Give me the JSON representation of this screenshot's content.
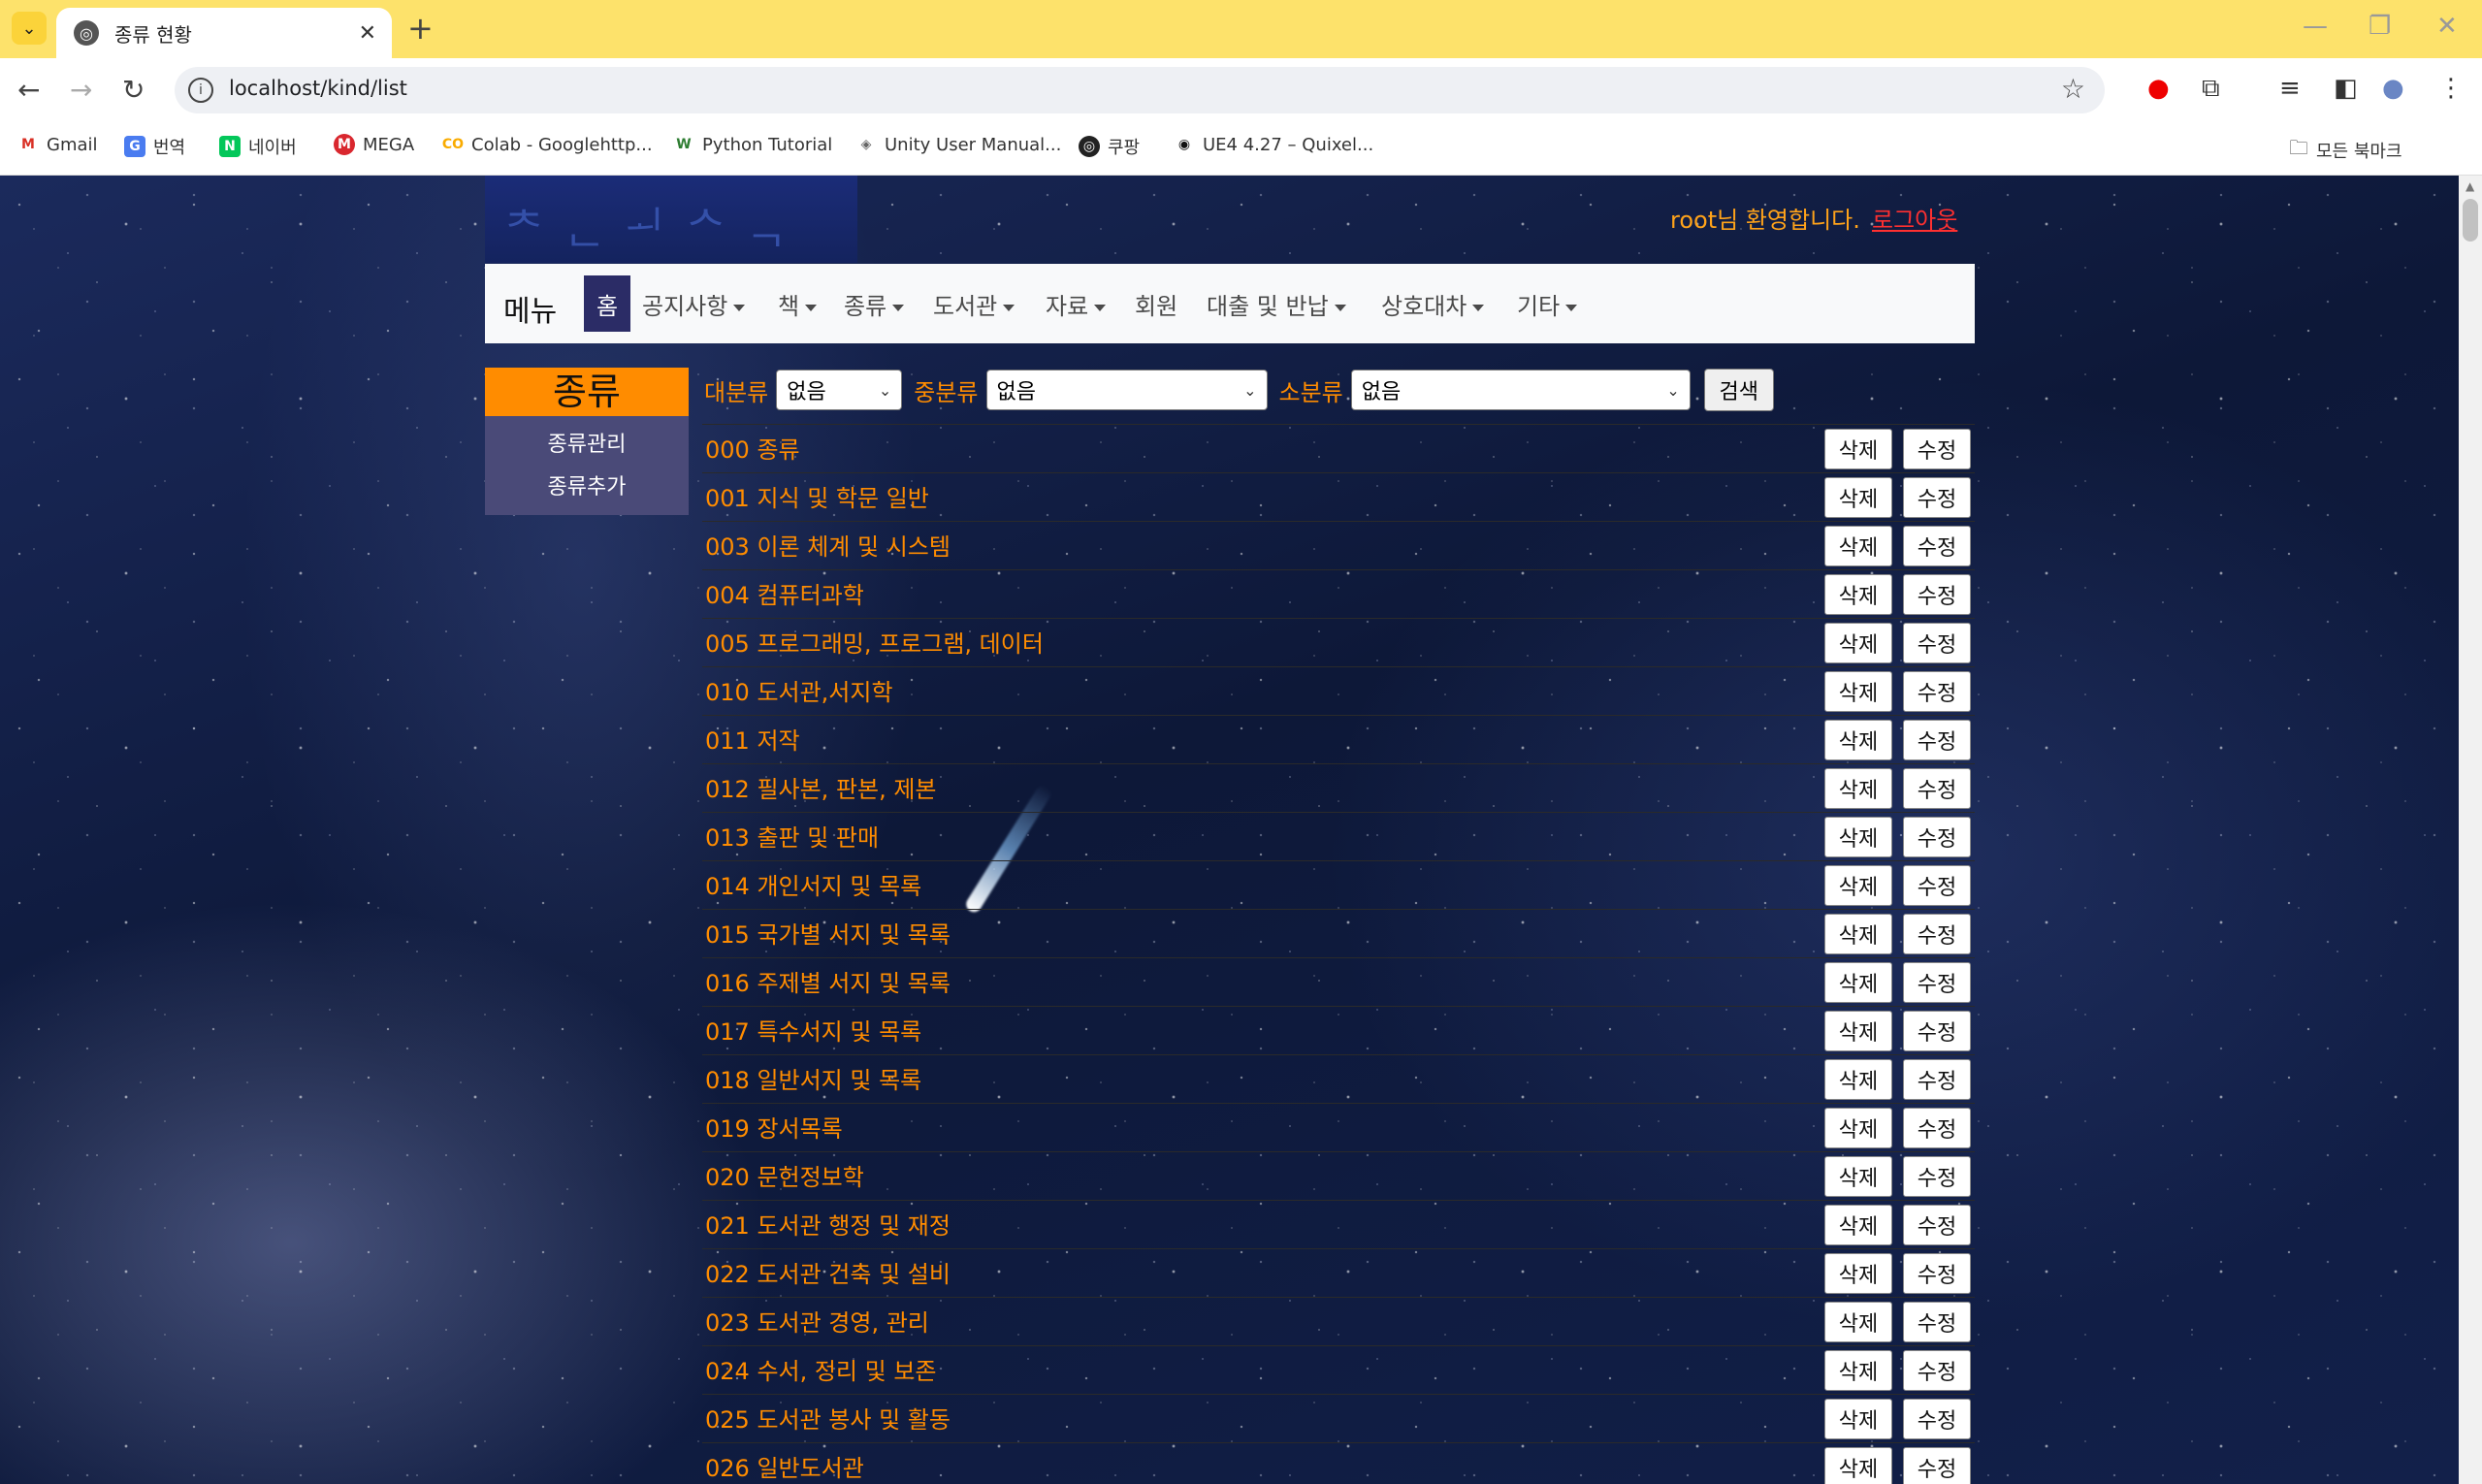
{
  "browser": {
    "tab_title": "종류 현황",
    "url": "localhost/kind/list",
    "bookmarks": [
      {
        "label": "Gmail",
        "icon": "gmail-icon"
      },
      {
        "label": "번역",
        "icon": "translate-icon"
      },
      {
        "label": "네이버",
        "icon": "naver-icon"
      },
      {
        "label": "MEGA",
        "icon": "mega-icon"
      },
      {
        "label": "Colab - Googlehttp...",
        "icon": "colab-icon"
      },
      {
        "label": "Python Tutorial",
        "icon": "python-icon"
      },
      {
        "label": "Unity User Manual...",
        "icon": "unity-icon"
      },
      {
        "label": "쿠팡",
        "icon": "globe-icon"
      },
      {
        "label": "UE4 4.27 – Quixel...",
        "icon": "quixel-icon"
      }
    ],
    "all_bookmarks": "모든 북마크"
  },
  "header": {
    "welcome": "root님 환영합니다.",
    "logout": "로그아웃"
  },
  "nav": {
    "brand": "메뉴",
    "home": "홈",
    "items": [
      {
        "label": "공지사항",
        "dropdown": true
      },
      {
        "label": "책",
        "dropdown": true
      },
      {
        "label": "종류",
        "dropdown": true
      },
      {
        "label": "도서관",
        "dropdown": true
      },
      {
        "label": "자료",
        "dropdown": true
      },
      {
        "label": "회원",
        "dropdown": false
      },
      {
        "label": "대출 및 반납",
        "dropdown": true
      },
      {
        "label": "상호대차",
        "dropdown": true
      },
      {
        "label": "기타",
        "dropdown": true
      }
    ]
  },
  "sidebar": {
    "title": "종류",
    "links": [
      "종류관리",
      "종류추가"
    ]
  },
  "filters": {
    "major_label": "대분류",
    "major_value": "없음",
    "middle_label": "중분류",
    "middle_value": "없음",
    "minor_label": "소분류",
    "minor_value": "없음",
    "search_button": "검색"
  },
  "list": {
    "delete_label": "삭제",
    "edit_label": "수정",
    "items": [
      "000 종류",
      "001 지식 및 학문 일반",
      "003 이론 체계 및 시스템",
      "004 컴퓨터과학",
      "005 프로그래밍, 프로그램, 데이터",
      "010 도서관,서지학",
      "011 저작",
      "012 필사본, 판본, 제본",
      "013 출판 및 판매",
      "014 개인서지 및 목록",
      "015 국가별 서지 및 목록",
      "016 주제별 서지 및 목록",
      "017 특수서지 및 목록",
      "018 일반서지 및 목록",
      "019 장서목록",
      "020 문헌정보학",
      "021 도서관 행정 및 재정",
      "022 도서관 건축 및 설비",
      "023 도서관 경영, 관리",
      "024 수서, 정리 및 보존",
      "025 도서관 봉사 및 활동",
      "026 일반도서관"
    ]
  },
  "colors": {
    "accent": "#ff8c00",
    "nav_active": "#2b2c66",
    "sidebar_bg": "#4a4a78",
    "logout": "#ff3030",
    "tabbar": "#fde26b"
  }
}
